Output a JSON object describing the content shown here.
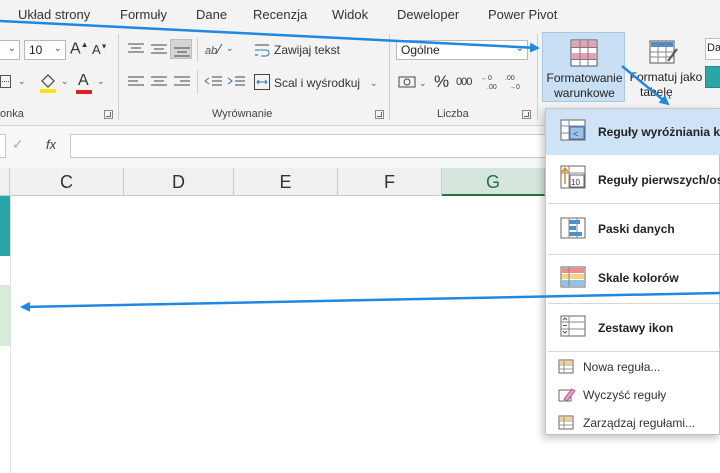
{
  "menu_tabs": [
    "Układ strony",
    "Formuły",
    "Dane",
    "Recenzja",
    "Widok",
    "Deweloper",
    "Power Pivot"
  ],
  "font": {
    "size_value": "10",
    "grow_label": "A",
    "shrink_label": "A",
    "color_label": "A",
    "group_label_partial": "onka"
  },
  "alignment": {
    "wrap_text_label": "Zawijaj tekst",
    "merge_center_label": "Scal i wyśrodkuj",
    "group_label": "Wyrównanie"
  },
  "number": {
    "format_value": "Ogólne",
    "percent_label": "%",
    "comma_label": "000",
    "group_label": "Liczba"
  },
  "styles": {
    "conditional_formatting_line1": "Formatowanie",
    "conditional_formatting_line2": "warunkowe",
    "format_as_table_line1": "Formatuj jako",
    "format_as_table_line2": "tabelę",
    "cell_styles_partial": "Da"
  },
  "formula_bar": {
    "fx_label": "fx",
    "check_label": "✓"
  },
  "columns": [
    "C",
    "D",
    "E",
    "F",
    "G"
  ],
  "active_column": "G",
  "dropdown": {
    "items_big": [
      {
        "label": "Reguły wyróżniania ko",
        "icon": "highlight-rules-icon",
        "highlighted": true
      },
      {
        "label": "Reguły pierwszych/ost",
        "icon": "top-bottom-rules-icon",
        "highlighted": false
      },
      {
        "label": "Paski danych",
        "icon": "data-bars-icon",
        "highlighted": false
      },
      {
        "label": "Skale kolorów",
        "icon": "color-scales-icon",
        "highlighted": false
      },
      {
        "label": "Zestawy ikon",
        "icon": "icon-sets-icon",
        "highlighted": false
      }
    ],
    "items_small": [
      {
        "label": "Nowa reguła...",
        "icon": "new-rule-icon"
      },
      {
        "label": "Wyczyść reguły",
        "icon": "clear-rules-icon"
      },
      {
        "label": "Zarządzaj regułami...",
        "icon": "manage-rules-icon"
      }
    ]
  },
  "colors": {
    "accent_teal": "#2aa6a6",
    "arrow_blue": "#1e88e5",
    "selection_green": "#d6ecd9",
    "menu_highlight": "#cfe3f6",
    "excel_green": "#217346"
  }
}
